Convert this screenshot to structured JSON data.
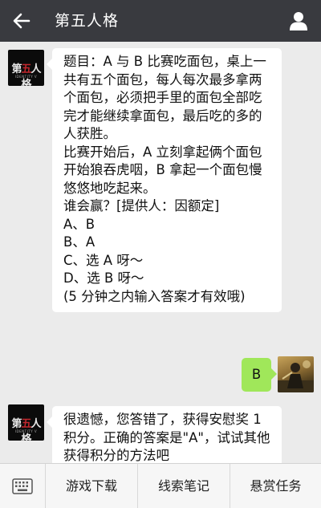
{
  "header": {
    "title": "第五人格",
    "back_icon": "arrow-left-icon",
    "user_icon": "user-icon"
  },
  "official_avatar": {
    "logo_prefix": "第",
    "logo_highlight": "五",
    "logo_suffix": "人格",
    "logo_sub": "IDENTITY V"
  },
  "messages": [
    {
      "sender": "official",
      "lines": [
        "题目：A 与 B 比赛吃面包，桌上一",
        "共有五个面包，每人每次最多拿两",
        "个面包，必须把手里的面包全部吃",
        "完才能继续拿面包，最后吃的多的",
        "人获胜。",
        "比赛开始后，A 立刻拿起俩个面包",
        "开始狼吞虎咽，B 拿起一个面包慢",
        "悠悠地吃起来。",
        "谁会赢？[提供人：因额定]",
        "A、B",
        "B、A",
        "C、选 A 呀～",
        "D、选 B 呀～",
        "(5 分钟之内输入答案才有效哦)"
      ]
    },
    {
      "sender": "user",
      "text": "B"
    },
    {
      "sender": "official",
      "lines": [
        "很遗憾，您答错了，获得安慰奖 1",
        "积分。正确的答案是\"A\"，试试其他",
        "获得积分的方法吧"
      ]
    }
  ],
  "bottom_menu": {
    "keyboard_icon": "keyboard-icon",
    "items": [
      "游戏下载",
      "线索笔记",
      "悬赏任务"
    ]
  },
  "colors": {
    "header_bg": "#393a3f",
    "chat_bg": "#ebebeb",
    "bubble_in": "#ffffff",
    "bubble_out": "#a0e75a"
  }
}
